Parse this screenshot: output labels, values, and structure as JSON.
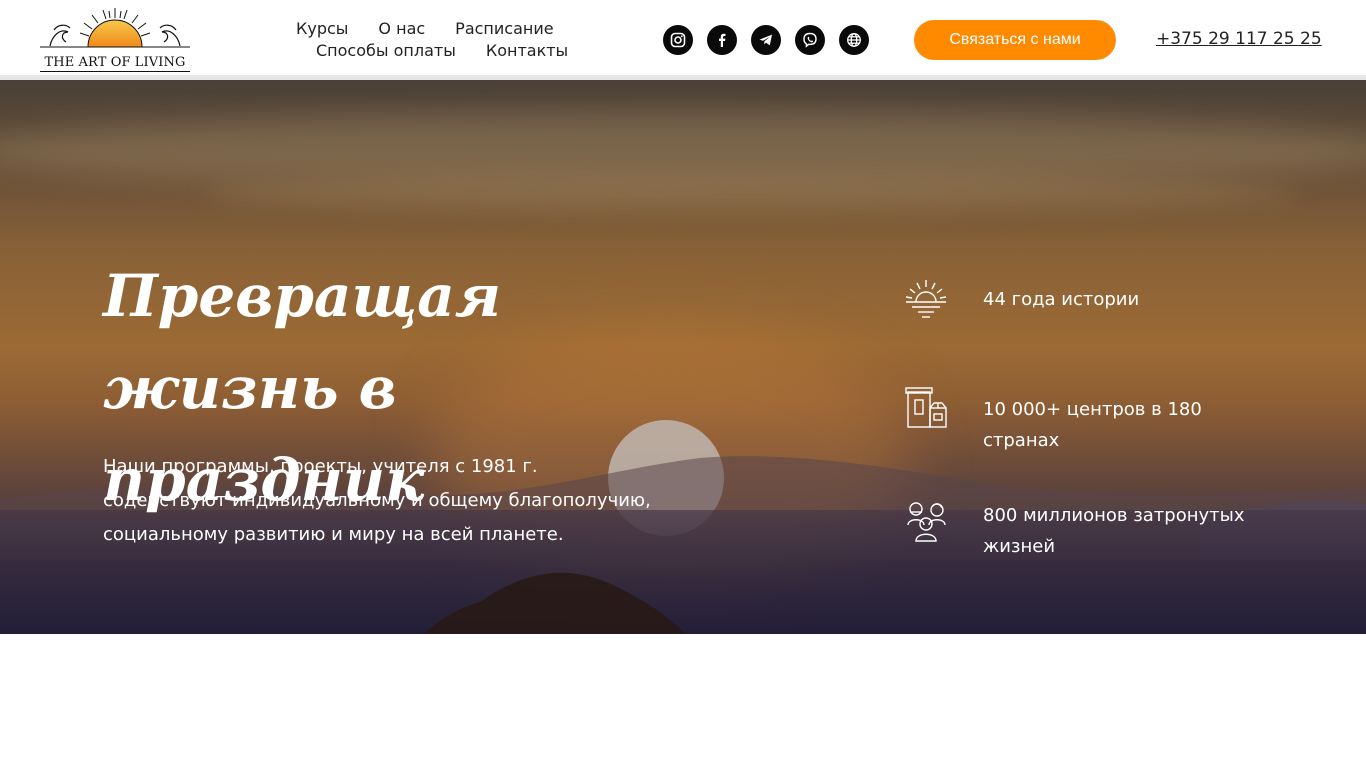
{
  "brand": {
    "logo_text": "THE ART OF LIVING"
  },
  "nav": {
    "row1": [
      "Курсы",
      "О нас",
      "Расписание"
    ],
    "row2": [
      "Способы оплаты",
      "Контакты"
    ]
  },
  "socials": [
    "instagram-icon",
    "facebook-icon",
    "telegram-icon",
    "viber-icon",
    "globe-icon"
  ],
  "header": {
    "cta_label": "Связаться с нами",
    "phone": "+375 29 117 25 25"
  },
  "hero": {
    "headline_line1": "Превращая жизнь в",
    "headline_line2": "праздник",
    "lead": "Наши программы, проекты, учителя с 1981 г. содействуют индивидуальному и общему благополучию, социальному развитию и миру на всей планете."
  },
  "stats": [
    {
      "icon": "sunrise-icon",
      "text": "44 года истории"
    },
    {
      "icon": "buildings-icon",
      "text": "10 000+ центров в 180 странах"
    },
    {
      "icon": "people-icon",
      "text": "800 миллионов затронутых жизней"
    }
  ],
  "colors": {
    "accent": "#ff8a00",
    "text_dark": "#222222",
    "icon_bg": "#0a0a0a"
  }
}
